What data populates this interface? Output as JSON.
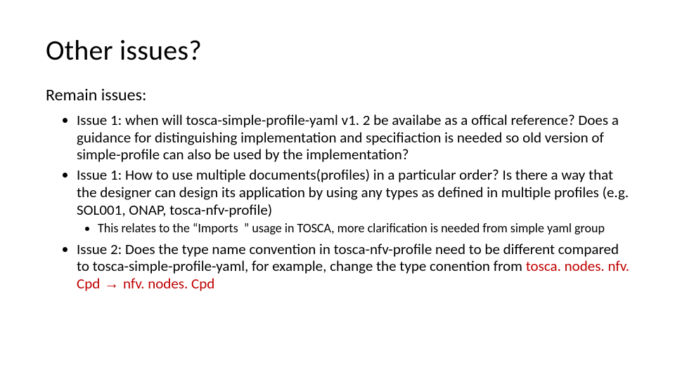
{
  "title": "Other issues?",
  "subhead": "Remain issues:",
  "items": {
    "i0": "Issue 1: when will tosca-simple-profile-yaml v1. 2 be availabe as a offical reference? Does a guidance for distinguishing implementation and specifiaction is needed so old version of simple-profile can also be used by the implementation?",
    "i1": "Issue 1: How to use multiple documents(profiles) in a particular order? Is there a way that the designer can design its application by using any types as defined in multiple profiles (e.g. SOL001, ONAP, tosca-nfv-profile)",
    "i1_sub": "This relates to the “Imports  ” usage in TOSCA, more clarification is needed from simple yaml group",
    "i2_lead": "Issue 2: Does the type name convention in tosca-nfv-profile need to be different compared to tosca-simple-profile-yaml, for example, change the type conention from ",
    "i2_red1": "tosca. nodes. nfv. Cpd",
    "i2_arrow": " → ",
    "i2_red2": "nfv. nodes. Cpd"
  }
}
